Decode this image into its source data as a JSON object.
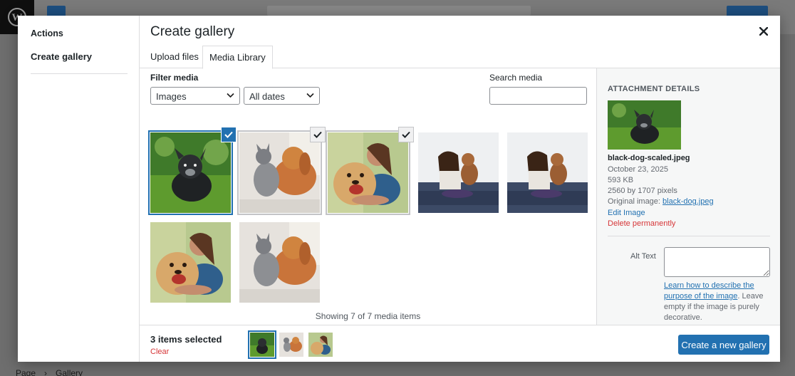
{
  "editor": {
    "breadcrumb": [
      "Page",
      "Gallery"
    ]
  },
  "modal": {
    "title": "Create gallery",
    "menu": {
      "heading": "Actions",
      "items": [
        "Create gallery"
      ]
    },
    "tabs": [
      {
        "label": "Upload files",
        "active": false
      },
      {
        "label": "Media Library",
        "active": true
      }
    ],
    "toolbar": {
      "filter_label": "Filter media",
      "type_selected": "Images",
      "date_selected": "All dates",
      "search_label": "Search media",
      "search_value": ""
    },
    "grid": {
      "items": [
        {
          "image": "black-dog",
          "selected": true,
          "details": true
        },
        {
          "image": "cat-and-dog",
          "selected": true,
          "details": false
        },
        {
          "image": "woman-hugging-dog",
          "selected": true,
          "details": false
        },
        {
          "image": "woman-on-couch-with-dog",
          "selected": false,
          "details": false
        },
        {
          "image": "woman-on-couch-with-dog",
          "selected": false,
          "details": false
        },
        {
          "image": "woman-hugging-dog",
          "selected": false,
          "details": false
        },
        {
          "image": "cat-and-dog",
          "selected": false,
          "details": false
        }
      ],
      "showing_text": "Showing 7 of 7 media items"
    },
    "sidebar": {
      "heading": "ATTACHMENT DETAILS",
      "filename": "black-dog-scaled.jpeg",
      "date": "October 23, 2025",
      "size": "593 KB",
      "dimensions": "2560 by 1707 pixels",
      "original_label": "Original image: ",
      "original_link": "black-dog.jpeg",
      "edit_link": "Edit Image",
      "delete_link": "Delete permanently",
      "alt_label": "Alt Text",
      "alt_value": "",
      "alt_help_link": "Learn how to describe the purpose of the image",
      "alt_help_text": ". Leave empty if the image is purely decorative."
    },
    "bottom": {
      "selected_count": "3 items selected",
      "clear": "Clear",
      "primary_button": "Create a new gallery"
    }
  },
  "colors": {
    "accent": "#2271b1",
    "danger": "#d63638",
    "overlay": "#6e6e6e"
  }
}
